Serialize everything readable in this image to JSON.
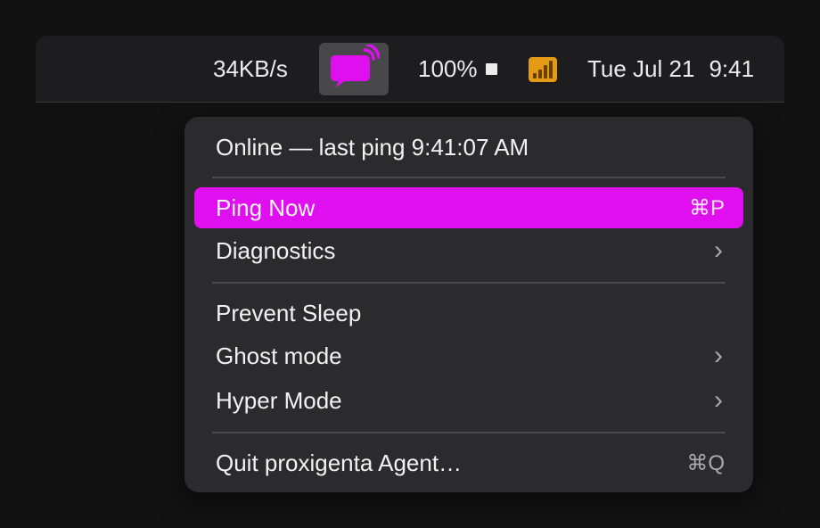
{
  "menubar": {
    "network_speed": "34KB/s",
    "app_icon": "chat-bubble-signal-icon",
    "battery_percent": "100%",
    "battery_icon": "battery-icon",
    "wifi_icon": "antenna-bars-icon",
    "date": "Tue Jul 21",
    "time": "9:41"
  },
  "menu": {
    "status": "Online — last ping 9:41:07 AM",
    "items": [
      {
        "label": "Ping Now",
        "shortcut": "⌘P",
        "highlighted": true
      },
      {
        "label": "Diagnostics",
        "submenu": "›"
      },
      {
        "label": "Prevent Sleep"
      },
      {
        "label": "Ghost mode",
        "submenu": "›"
      },
      {
        "label": "Hyper Mode",
        "submenu": "›"
      },
      {
        "label": "Quit proxigenta Agent…",
        "shortcut": "⌘Q"
      }
    ]
  },
  "colors": {
    "accent": "#e00ff0",
    "menu_bg": "#2b2b2d",
    "menubar_bg": "#1d1d1f",
    "desktop_bg": "#121212"
  }
}
